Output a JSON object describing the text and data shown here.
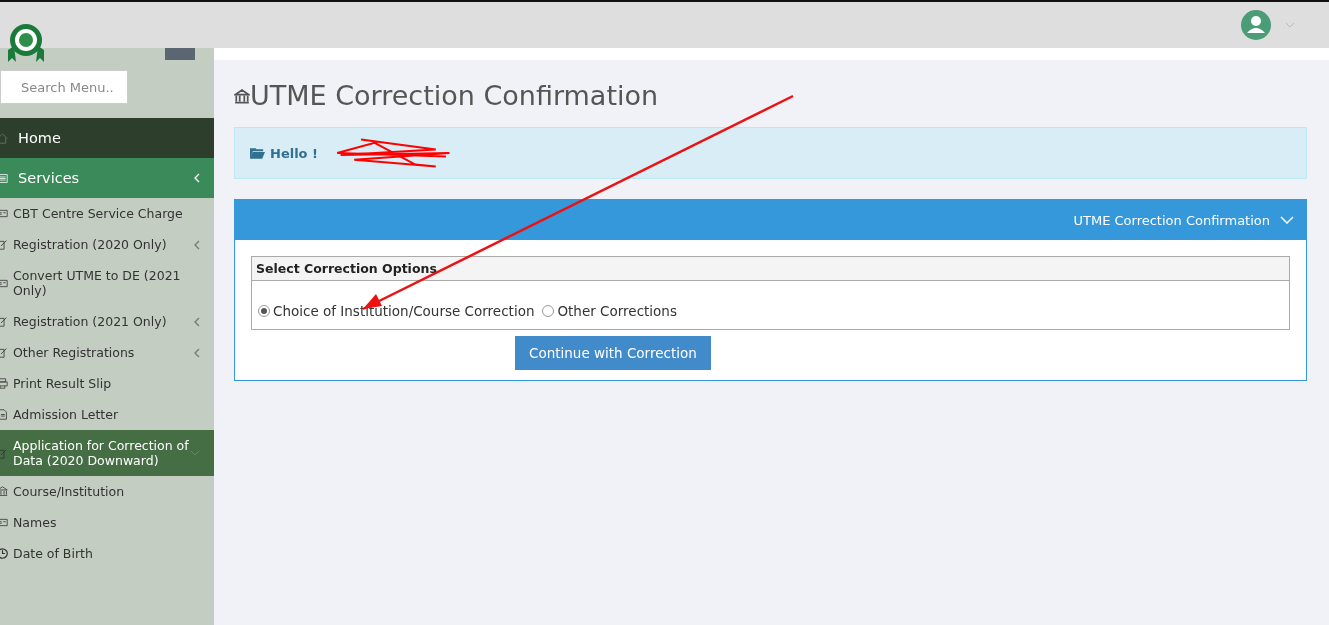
{
  "sidebar": {
    "search": {
      "placeholder": "Search Menu.."
    },
    "items": [
      {
        "label": "Home",
        "kind": "top",
        "selected": false
      },
      {
        "label": "Services",
        "kind": "top",
        "selected": true
      },
      {
        "label": "CBT Centre Service Charge",
        "kind": "link",
        "selected": false
      },
      {
        "label": "Registration (2020 Only)",
        "kind": "link",
        "selected": false
      },
      {
        "label": "Convert UTME to DE (2021 Only)",
        "kind": "link",
        "selected": false
      },
      {
        "label": "Registration (2021 Only)",
        "kind": "link",
        "selected": false
      },
      {
        "label": "Other Registrations",
        "kind": "link",
        "selected": false
      },
      {
        "label": "Print Result Slip",
        "kind": "link",
        "selected": false
      },
      {
        "label": "Admission Letter",
        "kind": "link",
        "selected": false
      },
      {
        "label": "Application for Correction of Data (2020 Downward)",
        "kind": "link",
        "selected": true
      },
      {
        "label": "Course/Institution",
        "kind": "sub",
        "selected": false
      },
      {
        "label": "Names",
        "kind": "sub",
        "selected": false
      },
      {
        "label": "Date of Birth",
        "kind": "sub",
        "selected": false
      }
    ]
  },
  "page": {
    "title": "UTME Correction Confirmation",
    "greeting": "Hello !",
    "panel": {
      "title": "UTME Correction Confirmation",
      "section_title": "Select Correction Options",
      "options": [
        {
          "label": "Choice of Institution/Course Correction",
          "selected": true
        },
        {
          "label": "Other Corrections",
          "selected": false
        }
      ],
      "button": "Continue with Correction"
    }
  }
}
